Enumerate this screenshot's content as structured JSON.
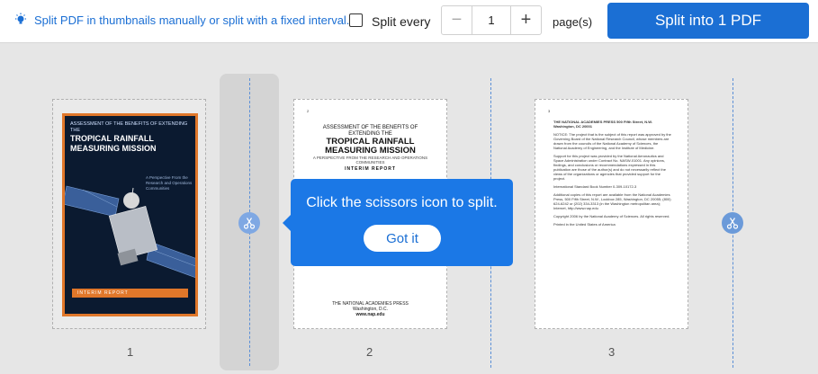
{
  "toolbar": {
    "hint_icon": "lightbulb-icon",
    "hint_text": "Split PDF in thumbnails manually or split with a fixed interval.",
    "split_every_label": "Split every",
    "interval_value": "1",
    "pages_label": "page(s)",
    "split_button_label": "Split into 1 PDF",
    "accent_color": "#1b6fd4"
  },
  "pages": [
    {
      "number": "1",
      "cover": {
        "title_small": "Assessment of the Benefits of Extending the",
        "title_big": "Tropical Rainfall Measuring Mission",
        "side_text": "A Perspective From the Research and Operations Communities",
        "band_text": "INTERIM REPORT",
        "publisher": "National Research Council"
      }
    },
    {
      "number": "2",
      "corner_mark": "2",
      "title_small": "ASSESSMENT OF THE BENEFITS OF EXTENDING THE",
      "title_big": "TROPICAL RAINFALL MEASURING MISSION",
      "subtitle": "A PERSPECTIVE FROM THE RESEARCH AND OPERATIONS COMMUNITIES",
      "interim": "INTERIM REPORT",
      "publisher_lines": [
        "THE NATIONAL ACADEMIES PRESS",
        "Washington, D.C.",
        "www.nap.edu"
      ]
    },
    {
      "number": "3",
      "corner_mark": "3",
      "header": "THE NATIONAL ACADEMIES PRESS 500 Fifth Street, N.W. Washington, DC 20001",
      "notice": "NOTICE: The project that is the subject of this report was approved by the Governing Board of the National Research Council, whose members are drawn from the councils of the National Academy of Sciences, the National Academy of Engineering, and the Institute of Medicine.",
      "support": "Support for this project was provided by the National Aeronautics and Space Administration under Contract No. NASW-01001. Any opinions, findings, and conclusions or recommendations expressed in this publication are those of the author(s) and do not necessarily reflect the views of the organizations or agencies that provided support for the project.",
      "isbn": "International Standard Book Number 0-309-10172-3",
      "availability": "Additional copies of this report are available from the National Academies Press, 500 Fifth Street, N.W., Lockbox 285, Washington, DC 20055; (800) 624-6242 or (202) 334-3313 (in the Washington metropolitan area); Internet, http://www.nap.edu",
      "copyright": "Copyright 2006 by the National Academy of Sciences. All rights reserved.",
      "printed": "Printed in the United States of America"
    }
  ],
  "tooltip": {
    "text": "Click the scissors icon to split.",
    "button_label": "Got it"
  }
}
